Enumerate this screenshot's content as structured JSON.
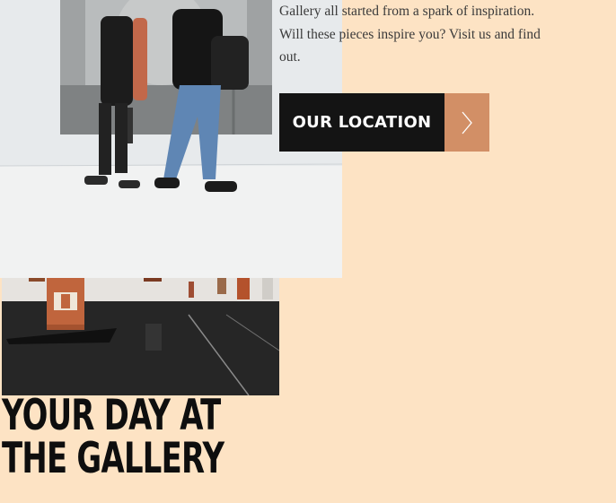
{
  "intro": {
    "line1": "Gallery all started from a spark of inspiration.",
    "line2": "Will these pieces inspire you? Visit us and find",
    "line3": "out."
  },
  "location_button": {
    "label": "OUR LOCATION",
    "icon": "chevron-right-icon"
  },
  "section_heading": {
    "line1": "YOUR DAY AT",
    "line2": "THE GALLERY"
  },
  "colors": {
    "page_background": "#fde3c4",
    "button_dark": "#141414",
    "button_accent": "#d28f66",
    "heading_text": "#0e0e0e"
  }
}
